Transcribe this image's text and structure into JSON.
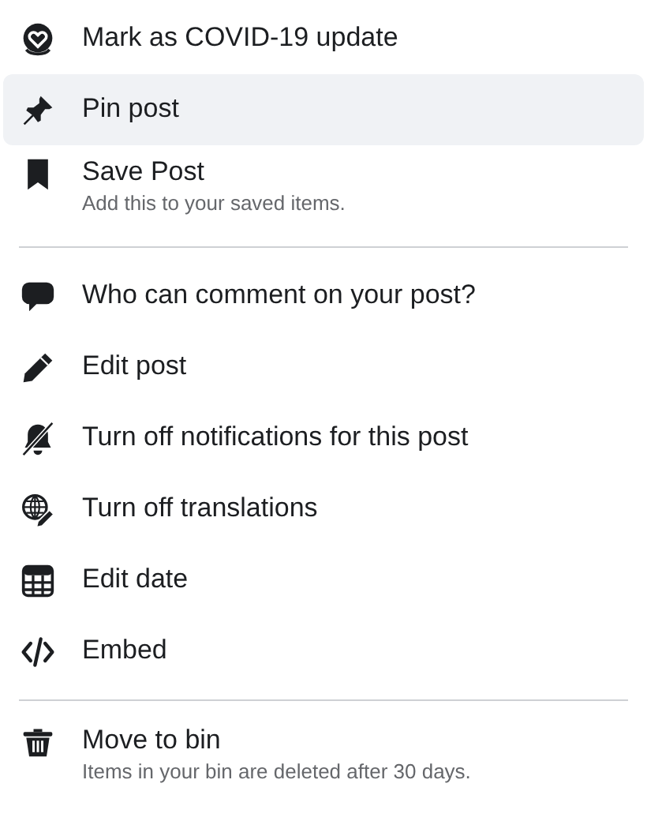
{
  "groups": [
    {
      "items": [
        {
          "kind": "covid",
          "label": "Mark as COVID-19 update",
          "selected": false
        },
        {
          "kind": "pin",
          "label": "Pin post",
          "selected": true
        },
        {
          "kind": "bookmark",
          "label": "Save Post",
          "description": "Add this to your saved items.",
          "selected": false
        }
      ]
    },
    {
      "items": [
        {
          "kind": "comment",
          "label": "Who can comment on your post?",
          "selected": false
        },
        {
          "kind": "pencil",
          "label": "Edit post",
          "selected": false
        },
        {
          "kind": "bell-off",
          "label": "Turn off notifications for this post",
          "selected": false
        },
        {
          "kind": "globe",
          "label": "Turn off translations",
          "selected": false
        },
        {
          "kind": "calendar",
          "label": "Edit date",
          "selected": false
        },
        {
          "kind": "code",
          "label": "Embed",
          "selected": false
        }
      ]
    },
    {
      "items": [
        {
          "kind": "trash",
          "label": "Move to bin",
          "description": "Items in your bin are deleted after 30 days.",
          "selected": false
        }
      ]
    }
  ]
}
